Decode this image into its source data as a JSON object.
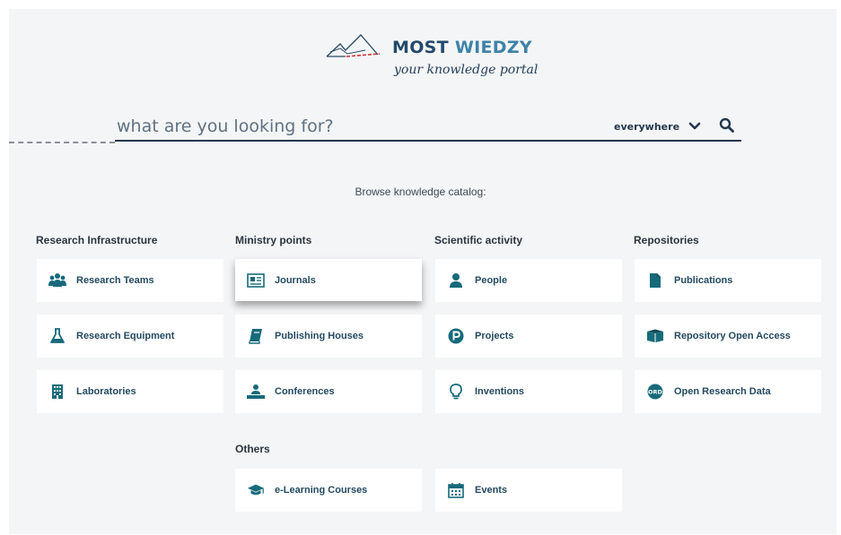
{
  "brand": {
    "name_part1": "MOST",
    "name_part2": "WIEDZY",
    "tagline": "your knowledge portal"
  },
  "search": {
    "placeholder": "what are you looking for?",
    "scope": "everywhere"
  },
  "browse_label": "Browse knowledge catalog:",
  "columns": [
    {
      "title": "Research Infrastructure",
      "items": [
        {
          "label": "Research Teams",
          "icon": "users-icon"
        },
        {
          "label": "Research Equipment",
          "icon": "flask-icon"
        },
        {
          "label": "Laboratories",
          "icon": "building-icon"
        }
      ]
    },
    {
      "title": "Ministry points",
      "items": [
        {
          "label": "Journals",
          "icon": "newspaper-icon"
        },
        {
          "label": "Publishing Houses",
          "icon": "book-icon"
        },
        {
          "label": "Conferences",
          "icon": "presenter-icon"
        }
      ]
    },
    {
      "title": "Scientific activity",
      "items": [
        {
          "label": "People",
          "icon": "person-icon"
        },
        {
          "label": "Projects",
          "icon": "p-circle-icon"
        },
        {
          "label": "Inventions",
          "icon": "lightbulb-icon"
        }
      ]
    },
    {
      "title": "Repositories",
      "items": [
        {
          "label": "Publications",
          "icon": "file-icon"
        },
        {
          "label": "Repository Open Access",
          "icon": "open-book-icon"
        },
        {
          "label": "Open Research Data",
          "icon": "ord-icon"
        }
      ]
    }
  ],
  "others": {
    "title": "Others",
    "items": [
      {
        "label": "e-Learning Courses",
        "icon": "graduation-cap-icon"
      },
      {
        "label": "Events",
        "icon": "calendar-icon"
      }
    ]
  },
  "colors": {
    "navy": "#22384f",
    "teal_icon": "#176a7a",
    "logo_dash": "#d0343a"
  }
}
